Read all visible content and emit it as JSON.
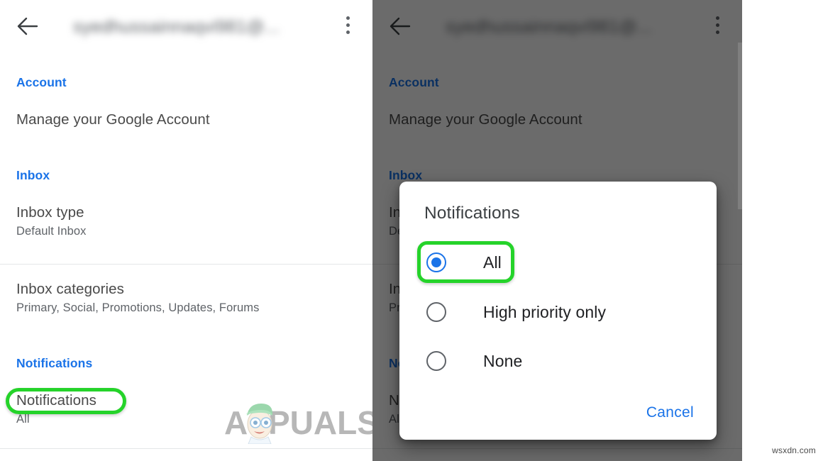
{
  "appbar": {
    "back_icon": "arrow-left-icon",
    "title": "syedhussainnaqvi981@...",
    "overflow_icon": "more-vert-icon"
  },
  "settings": {
    "sections": [
      {
        "header": "Account",
        "rows": [
          {
            "title": "Manage your Google Account",
            "sub": ""
          }
        ]
      },
      {
        "header": "Inbox",
        "rows": [
          {
            "title": "Inbox type",
            "sub": "Default Inbox"
          },
          {
            "title": "Inbox categories",
            "sub": "Primary, Social, Promotions, Updates, Forums"
          }
        ]
      },
      {
        "header": "Notifications",
        "rows": [
          {
            "title": "Notifications",
            "sub": "All"
          }
        ]
      }
    ]
  },
  "dialog": {
    "title": "Notifications",
    "options": [
      {
        "label": "All",
        "selected": true
      },
      {
        "label": "High priority only",
        "selected": false
      },
      {
        "label": "None",
        "selected": false
      }
    ],
    "cancel_label": "Cancel"
  },
  "annotations": {
    "highlight_color": "#25d32a",
    "highlighted_left_row": "Notifications",
    "highlighted_dialog_option": "All"
  },
  "branding": {
    "logo_text": "PUALS",
    "logo_initial": "A",
    "watermark": "wsxdn.com"
  },
  "colors": {
    "accent_blue": "#1a73e8",
    "text_primary": "#3c4043",
    "text_secondary": "#5f6368",
    "highlight_green": "#25d32a",
    "scrim": "rgba(0,0,0,.58)"
  }
}
